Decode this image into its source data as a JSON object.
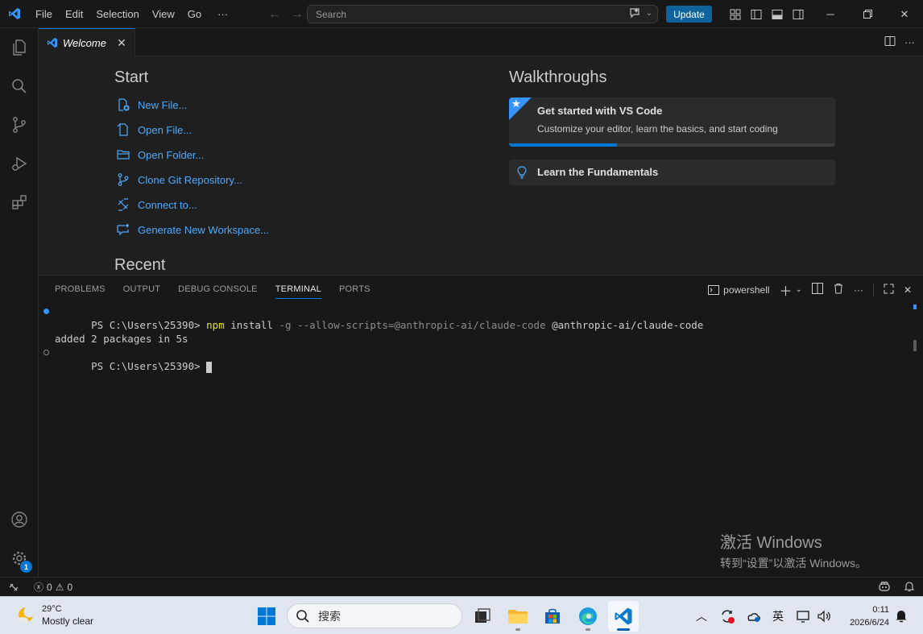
{
  "titlebar": {
    "menu": [
      "File",
      "Edit",
      "Selection",
      "View",
      "Go",
      "···"
    ],
    "search_placeholder": "Search",
    "update_label": "Update"
  },
  "tab": {
    "label": "Welcome",
    "close_glyph": "✕"
  },
  "welcome": {
    "start_title": "Start",
    "start_items": [
      "New File...",
      "Open File...",
      "Open Folder...",
      "Clone Git Repository...",
      "Connect to...",
      "Generate New Workspace..."
    ],
    "recent_title": "Recent",
    "walkthroughs_title": "Walkthroughs",
    "card1_title": "Get started with VS Code",
    "card1_desc": "Customize your editor, learn the basics, and start coding",
    "card1_progress": 0.33,
    "card2_title": "Learn the Fundamentals"
  },
  "panel": {
    "tabs": [
      "PROBLEMS",
      "OUTPUT",
      "DEBUG CONSOLE",
      "TERMINAL",
      "PORTS"
    ],
    "active_tab": "TERMINAL",
    "shell_label": "powershell",
    "terminal": {
      "prompt1": "PS C:\\Users\\25390> ",
      "cmd_npm": "npm",
      "cmd_install": " install ",
      "cmd_flags": "-g --allow-scripts=@anthropic-ai/claude-code",
      "cmd_pkg": " @anthropic-ai/claude-code",
      "output": "added 2 packages in 5s",
      "prompt2": "PS C:\\Users\\25390> "
    }
  },
  "watermark": {
    "line1": "激活 Windows",
    "line2": "转到“设置”以激活 Windows。"
  },
  "statusbar": {
    "errors": "0",
    "warnings": "0"
  },
  "taskbar": {
    "temperature": "29°C",
    "weather": "Mostly clear",
    "search_label": "搜索",
    "ime": "英",
    "time": "0:11",
    "date": "2026/6/24"
  },
  "colors": {
    "accent": "#0078d4",
    "link": "#4daafc",
    "background": "#1f1f1f",
    "update_button": "#0e639c"
  }
}
